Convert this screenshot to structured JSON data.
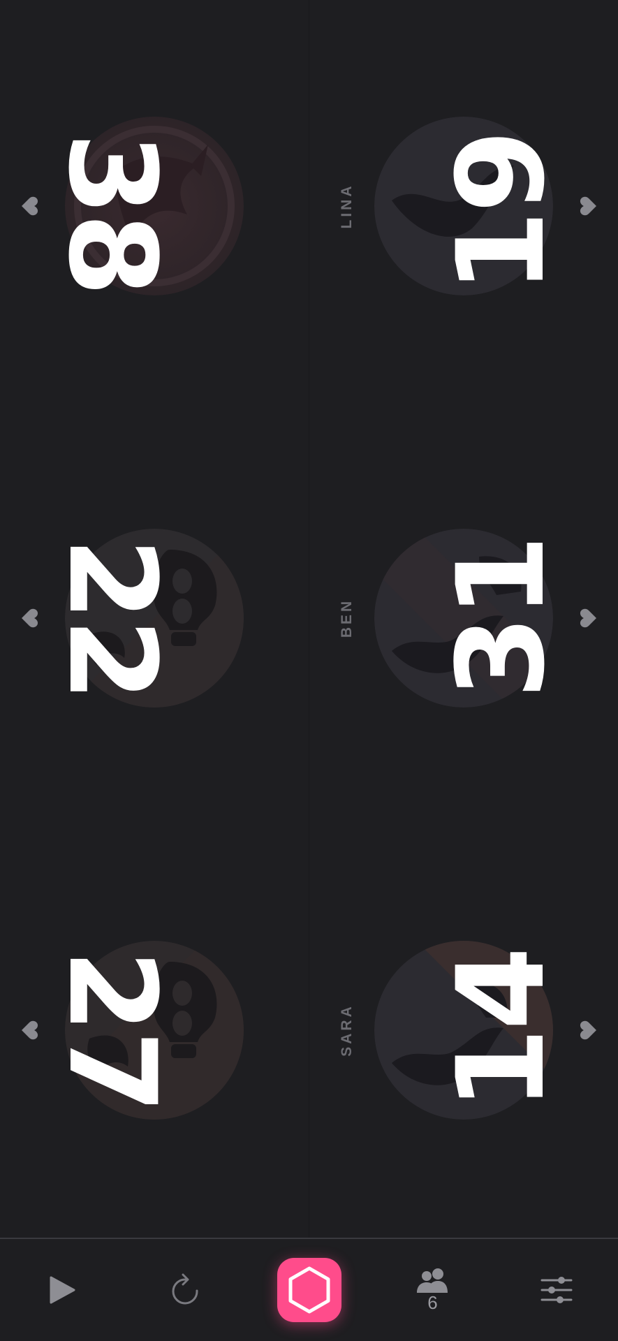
{
  "players": [
    {
      "name": "",
      "life": "38",
      "side": "left",
      "row": 0,
      "avatar": "dragon-avatar"
    },
    {
      "name": "LINA",
      "life": "19",
      "side": "right",
      "row": 0,
      "avatar": "horn-avatar"
    },
    {
      "name": "",
      "life": "22",
      "side": "left",
      "row": 1,
      "avatar": "skull-avatar"
    },
    {
      "name": "BEN",
      "life": "31",
      "side": "right",
      "row": 1,
      "avatar": "horn-avatar"
    },
    {
      "name": "",
      "life": "27",
      "side": "left",
      "row": 2,
      "avatar": "skull-avatar"
    },
    {
      "name": "SARA",
      "life": "14",
      "side": "right",
      "row": 2,
      "avatar": "horn-avatar"
    }
  ],
  "bottom_bar": {
    "play_icon": "play-icon",
    "reset_icon": "refresh-icon",
    "main_icon": "hexagon-icon",
    "players_icon": "people-icon",
    "player_count": "6",
    "settings_icon": "sliders-icon"
  },
  "colors": {
    "background": "#1e1e21",
    "accent": "#ff4c8b",
    "life_text": "#ffffff",
    "name_text": "#6c6c72",
    "heart": "#8a8a90"
  }
}
